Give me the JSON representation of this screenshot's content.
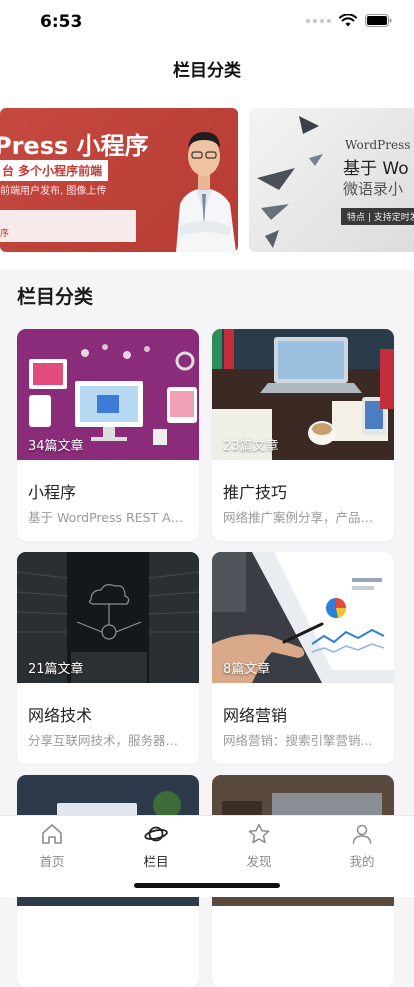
{
  "status_bar": {
    "time": "6:53"
  },
  "nav": {
    "title": "栏目分类"
  },
  "banners": [
    {
      "title": "Press 小程序",
      "subtitle": "台 多个小程序前端",
      "description": "前端用户发布, 图像上传",
      "footer": "序"
    },
    {
      "brand": "WordPress",
      "title": "基于 Wo",
      "subtitle": "微语录小",
      "tag": "特点 | 支持定时发"
    }
  ],
  "section": {
    "title": "栏目分类"
  },
  "categories": [
    {
      "count": "34篇文章",
      "title": "小程序",
      "description": "基于 WordPress REST API..."
    },
    {
      "count": "23篇文章",
      "title": "推广技巧",
      "description": "网络推广案例分享，产品推广..."
    },
    {
      "count": "21篇文章",
      "title": "网络技术",
      "description": "分享互联网技术，服务器运维..."
    },
    {
      "count": "8篇文章",
      "title": "网络营销",
      "description": "网络营销：搜索引擎营销..."
    }
  ],
  "tabbar": {
    "items": [
      {
        "label": "首页",
        "icon": "home-icon"
      },
      {
        "label": "栏目",
        "icon": "planet-icon"
      },
      {
        "label": "发现",
        "icon": "star-icon"
      },
      {
        "label": "我的",
        "icon": "user-icon"
      }
    ],
    "active": "栏目"
  },
  "colors": {
    "accent": "#222222",
    "banner_red": "#c5493f",
    "inactive": "#8c8c8c"
  }
}
